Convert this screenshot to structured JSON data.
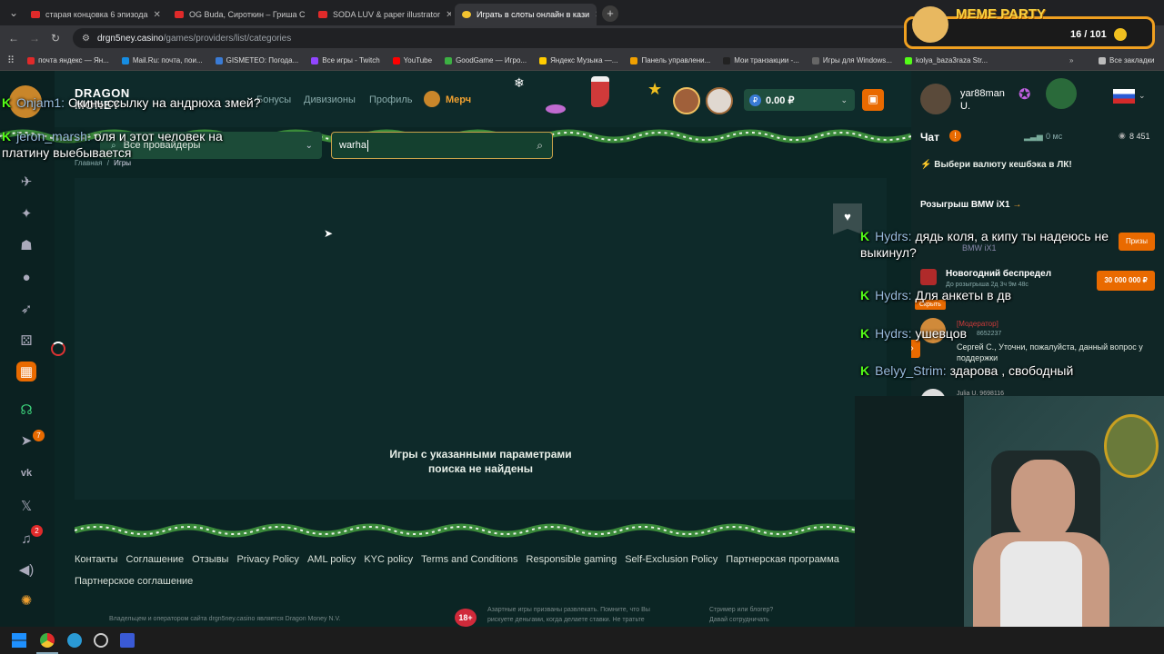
{
  "browser": {
    "tabs": [
      {
        "title": "старая концовка 6 эпизода",
        "fav_color": "#e02a2a"
      },
      {
        "title": "OG Buda, Сироткин – Гриша С",
        "fav_color": "#e02a2a"
      },
      {
        "title": "SODA LUV & paper illustrator",
        "fav_color": "#e02a2a"
      },
      {
        "title": "Играть в слоты онлайн в кази",
        "fav_color": "#f4c430",
        "active": true
      }
    ],
    "url_host": "drgn5ney.casino",
    "url_path": "/games/providers/list/categories",
    "bookmarks": [
      {
        "label": "почта яндекс — Ян...",
        "color": "#e02a2a"
      },
      {
        "label": "Mail.Ru: почта, пои...",
        "color": "#168de2"
      },
      {
        "label": "GISMETEO: Погода...",
        "color": "#3a7bd5"
      },
      {
        "label": "Все игры - Twitch",
        "color": "#9146ff"
      },
      {
        "label": "YouTube",
        "color": "#ff0000"
      },
      {
        "label": "GoodGame — Игро...",
        "color": "#3cb043"
      },
      {
        "label": "Яндекс Музыка —...",
        "color": "#ffcc00"
      },
      {
        "label": "Панель управлени...",
        "color": "#f0a000"
      },
      {
        "label": "Мои транзакции -...",
        "color": "#222"
      },
      {
        "label": "Игры для Windows...",
        "color": "#666"
      },
      {
        "label": "kolya_baza3raza Str...",
        "color": "#53fc18"
      }
    ],
    "all_bookmarks": "Все закладки"
  },
  "site": {
    "logo_line1": "DRAGON",
    "logo_line2": "MONEY",
    "nav": [
      "Бонусы",
      "Дивизионы",
      "Профиль"
    ],
    "merch": "Мерч",
    "balance": "0.00 ₽",
    "breadcrumb_home": "Главная",
    "breadcrumb_sep": "/",
    "breadcrumb_current": "Игры",
    "provider_select": "Все провайдеры",
    "search_value": "warha",
    "empty_line1": "Игры с указанными параметрами",
    "empty_line2": "поиска не найдены",
    "footer_links": [
      "Контакты",
      "Соглашение",
      "Отзывы",
      "Privacy Policy",
      "AML policy",
      "KYC policy",
      "Terms and Conditions",
      "Responsible gaming",
      "Self-Exclusion Policy",
      "Партнерская программа",
      "Партнерское соглашение"
    ],
    "footer_legal": "Владельцем и оператором сайта drgn5ney.casino является Dragon Money N.V.",
    "age_badge": "18+",
    "footer_warn1": "Азартные игры призваны развлекать. Помните, что Вы",
    "footer_warn2": "рискуете деньгами, когда делаете ставки. Не тратьте",
    "footer_streamer1": "Стример или блогер?",
    "footer_streamer2": "Давай сотрудничать",
    "nav_badges": [
      "7",
      "2"
    ]
  },
  "right": {
    "username": "yar88man",
    "user_sub": "U.",
    "chat_title": "Чат",
    "ping": "0 мс",
    "online": "8 451",
    "cashback": "Выбери валюту кешбэка в ЛК!",
    "raffle": "Розыгрыш BMW iX1",
    "raffle_item": "BMW iX1",
    "raffle_btn": "Призы",
    "newyear_title": "Новогодний беспредел",
    "newyear_timer": "До розыгрыша  2д 3ч 9м 48с",
    "newyear_prize": "30 000 000 ₽",
    "hide": "Скрыть",
    "mod_label": "[Модератор]",
    "mod_id": "8652237",
    "mod_msg": "Сергей С., Уточни, пожалуйста, данный вопрос у поддержки",
    "last_user": "Julia U.",
    "last_id": "9698116"
  },
  "stream_overlay": {
    "meme_title": "MEME PARTY",
    "meme_count": "16 / 101",
    "left_chat": [
      {
        "user": "Onjam1:",
        "msg": "Скинь ссылку на андрюха змей?"
      },
      {
        "user": "jeron_marsh:",
        "msg": "оля и этот человек на платину выебывается"
      }
    ],
    "right_chat": [
      {
        "user": "Hydrs:",
        "msg": "дядь коля, а кипу ты надеюсь не выкинул?"
      },
      {
        "user": "Hydrs:",
        "msg": "Для анкеты в дв"
      },
      {
        "user": "Hydrs:",
        "msg": "ушевцов"
      },
      {
        "user": "Belyy_Strim:",
        "msg": "здарова , свободный"
      }
    ]
  }
}
